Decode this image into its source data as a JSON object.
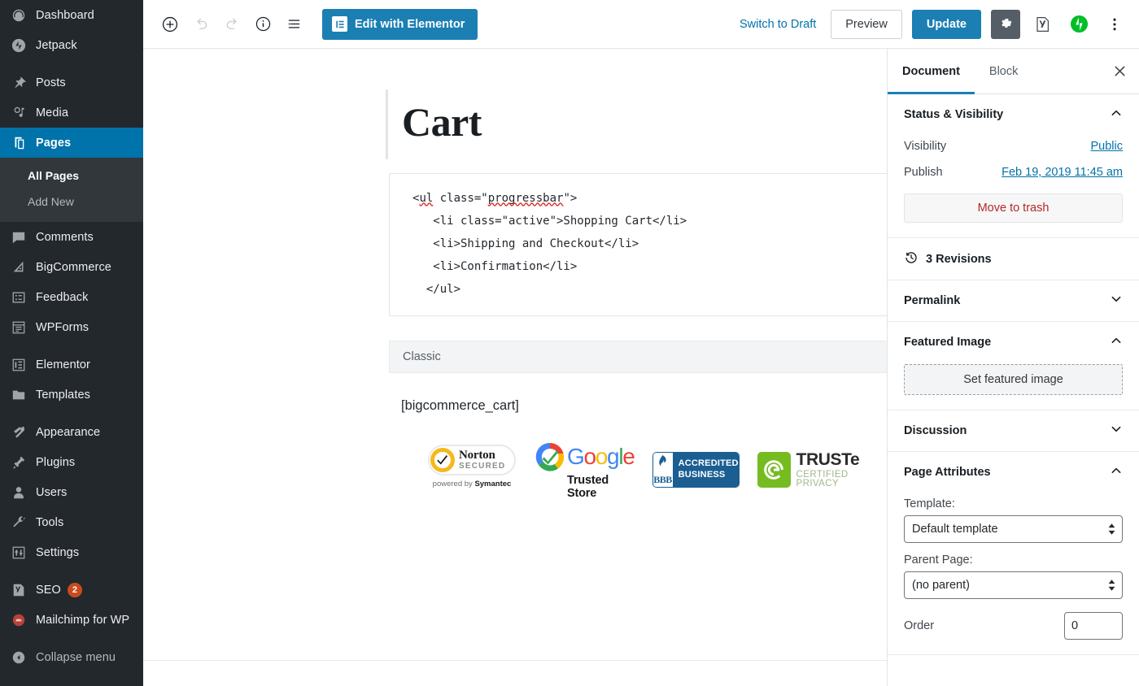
{
  "admin_menu": {
    "items": [
      {
        "label": "Dashboard",
        "icon": "dashboard-icon",
        "current": false
      },
      {
        "label": "Jetpack",
        "icon": "jetpack-icon",
        "current": false
      },
      {
        "label": "Posts",
        "icon": "pin-icon",
        "current": false
      },
      {
        "label": "Media",
        "icon": "media-icon",
        "current": false
      },
      {
        "label": "Pages",
        "icon": "pages-icon",
        "current": true
      },
      {
        "label": "Comments",
        "icon": "comment-icon",
        "current": false
      },
      {
        "label": "BigCommerce",
        "icon": "bigcommerce-icon",
        "current": false
      },
      {
        "label": "Feedback",
        "icon": "feedback-icon",
        "current": false
      },
      {
        "label": "WPForms",
        "icon": "wpforms-icon",
        "current": false
      },
      {
        "label": "Elementor",
        "icon": "elementor-icon",
        "current": false
      },
      {
        "label": "Templates",
        "icon": "folder-icon",
        "current": false
      },
      {
        "label": "Appearance",
        "icon": "brush-icon",
        "current": false
      },
      {
        "label": "Plugins",
        "icon": "plugin-icon",
        "current": false
      },
      {
        "label": "Users",
        "icon": "user-icon",
        "current": false
      },
      {
        "label": "Tools",
        "icon": "wrench-icon",
        "current": false
      },
      {
        "label": "Settings",
        "icon": "settings-icon",
        "current": false
      },
      {
        "label": "SEO",
        "icon": "yoast-icon",
        "current": false,
        "badge": "2"
      },
      {
        "label": "Mailchimp for WP",
        "icon": "mailchimp-icon",
        "current": false
      }
    ],
    "submenu": [
      {
        "label": "All Pages",
        "current": true
      },
      {
        "label": "Add New",
        "current": false
      }
    ],
    "collapse_label": "Collapse menu",
    "highlight_color": "#0073aa",
    "background_color": "#23282d",
    "badge_color": "#ca4a1f"
  },
  "toolbar": {
    "add_block_icon": "plus-circle-icon",
    "undo_icon": "undo-icon",
    "redo_icon": "redo-icon",
    "info_icon": "info-circle-icon",
    "outline_icon": "list-view-icon",
    "elementor_label": "Edit with Elementor",
    "switch_to_draft_label": "Switch to Draft",
    "preview_label": "Preview",
    "update_label": "Update",
    "settings_icon": "gear-icon",
    "yoast_icon": "yoast-icon",
    "jetpack_icon": "jetpack-icon",
    "more_icon": "kebab-menu-icon",
    "primary_color": "#1b7fb3",
    "link_color": "#0073aa"
  },
  "editor": {
    "post_title": "Cart",
    "code_block": {
      "line1_a": "<",
      "line1_ul": "ul",
      "line1_b": " class=\"",
      "line1_cls": "progressbar",
      "line1_c": "\">",
      "line2": "   <li class=\"active\">Shopping Cart</li>",
      "line3": "   <li>Shipping and Checkout</li>",
      "line4": "   <li>Confirmation</li>",
      "line5": "  </ul>"
    },
    "classic_block_label": "Classic",
    "shortcode": "[bigcommerce_cart]",
    "badges": {
      "norton": {
        "title": "Norton",
        "subtitle": "SECURED",
        "footer_pre": "powered by ",
        "footer_brand": "Symantec"
      },
      "google": {
        "letters": [
          "G",
          "o",
          "o",
          "g",
          "l",
          "e"
        ],
        "subtitle": "Trusted Store"
      },
      "bbb": {
        "mark": "BBB",
        "line1": "ACCREDITED",
        "line2": "BUSINESS"
      },
      "truste": {
        "title": "TRUSTe",
        "subtitle": "CERTIFIED PRIVACY"
      }
    }
  },
  "settings_panel": {
    "tabs": [
      {
        "label": "Document",
        "active": true
      },
      {
        "label": "Block",
        "active": false
      }
    ],
    "close_icon": "close-icon",
    "status_visibility": {
      "title": "Status & Visibility",
      "expanded": true,
      "visibility_label": "Visibility",
      "visibility_value": "Public",
      "publish_label": "Publish",
      "publish_value": "Feb 19, 2019 11:45 am",
      "trash_label": "Move to trash"
    },
    "revisions": {
      "label": "3 Revisions",
      "icon": "history-icon"
    },
    "permalink": {
      "title": "Permalink",
      "expanded": false
    },
    "featured_image": {
      "title": "Featured Image",
      "expanded": true,
      "set_label": "Set featured image"
    },
    "discussion": {
      "title": "Discussion",
      "expanded": false
    },
    "page_attributes": {
      "title": "Page Attributes",
      "expanded": true,
      "template_label": "Template:",
      "template_value": "Default template",
      "parent_label": "Parent Page:",
      "parent_value": "(no parent)",
      "order_label": "Order",
      "order_value": "0"
    }
  }
}
